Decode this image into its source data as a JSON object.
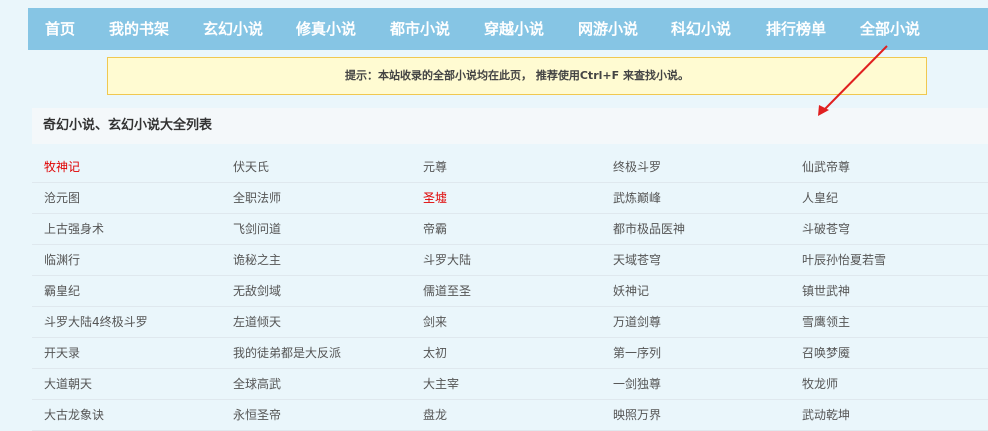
{
  "nav": {
    "items": [
      "首页",
      "我的书架",
      "玄幻小说",
      "修真小说",
      "都市小说",
      "穿越小说",
      "网游小说",
      "科幻小说",
      "排行榜单",
      "全部小说"
    ]
  },
  "tip": {
    "text": "提示：本站收录的全部小说均在此页， 推荐使用Ctrl+F 来查找小说。"
  },
  "section": {
    "title": "奇幻小说、玄幻小说大全列表"
  },
  "books": [
    [
      "牧神记",
      "伏天氏",
      "元尊",
      "终极斗罗",
      "仙武帝尊"
    ],
    [
      "沧元图",
      "全职法师",
      "圣墟",
      "武炼巅峰",
      "人皇纪"
    ],
    [
      "上古强身术",
      "飞剑问道",
      "帝霸",
      "都市极品医神",
      "斗破苍穹"
    ],
    [
      "临渊行",
      "诡秘之主",
      "斗罗大陆",
      "天域苍穹",
      "叶辰孙怡夏若雪"
    ],
    [
      "霸皇纪",
      "无敌剑域",
      "儒道至圣",
      "妖神记",
      "镇世武神"
    ],
    [
      "斗罗大陆4终极斗罗",
      "左道倾天",
      "剑来",
      "万道剑尊",
      "雪鹰领主"
    ],
    [
      "开天录",
      "我的徒弟都是大反派",
      "太初",
      "第一序列",
      "召唤梦魇"
    ],
    [
      "大道朝天",
      "全球高武",
      "大主宰",
      "一剑独尊",
      "牧龙师"
    ],
    [
      "大古龙象诀",
      "永恒圣帝",
      "盘龙",
      "映照万界",
      "武动乾坤"
    ]
  ],
  "highlighted": [
    "牧神记",
    "圣墟"
  ],
  "colors": {
    "nav_bg": "#86c5e4",
    "page_bg": "#eaf6fb",
    "tip_bg": "#fffbd2",
    "highlight": "#e00000",
    "arrow": "#e02020"
  }
}
